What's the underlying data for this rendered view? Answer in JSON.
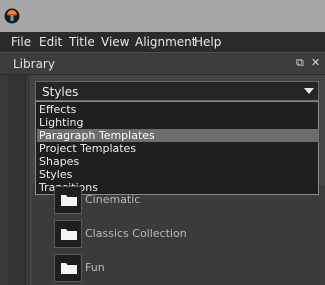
{
  "menubar": {
    "items": [
      "File",
      "Edit",
      "Title",
      "View",
      "Alignment",
      "Help"
    ]
  },
  "panel": {
    "title": "Library",
    "restore_glyph": "⧉",
    "close_glyph": "✕"
  },
  "combo": {
    "selected": "Styles"
  },
  "dropdown": {
    "options": [
      "Effects",
      "Lighting",
      "Paragraph Templates",
      "Project Templates",
      "Shapes",
      "Styles",
      "Transitions"
    ],
    "highlighted": "Paragraph Templates"
  },
  "library_items": [
    {
      "label": "Cinematic",
      "icon": "folder-icon"
    },
    {
      "label": "Classics Collection",
      "icon": "folder-icon"
    },
    {
      "label": "Fun",
      "icon": "folder-icon"
    }
  ],
  "colors": {
    "titlebar": "#a7a7a7",
    "menubar": "#2b2b2b",
    "highlight": "#6d6d6d"
  }
}
